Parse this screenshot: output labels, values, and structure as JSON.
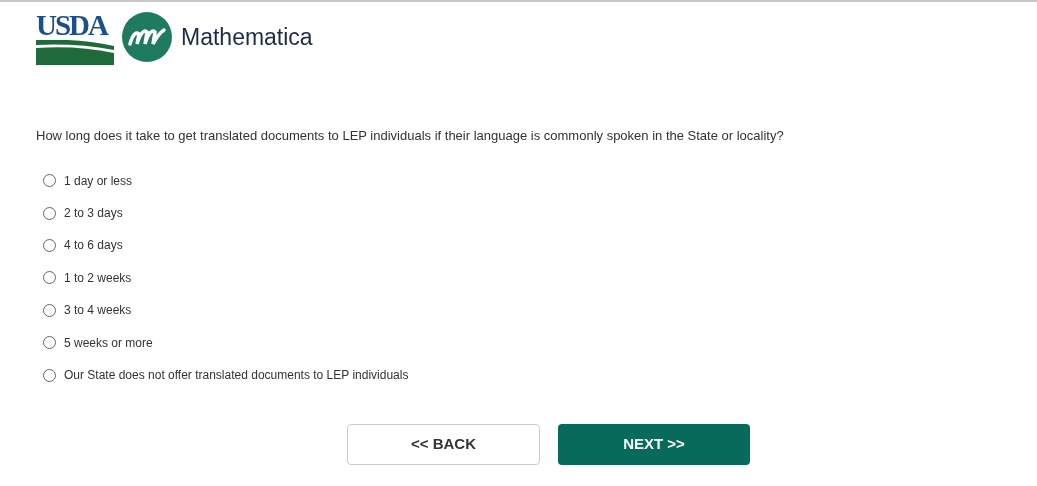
{
  "header": {
    "agency_logo": "USDA",
    "partner_logo": "Mathematica"
  },
  "question": "How long does it take to get translated documents to LEP individuals if their language is commonly spoken in the State or locality?",
  "options": [
    {
      "label": "1 day or less",
      "selected": false
    },
    {
      "label": "2 to 3 days",
      "selected": false
    },
    {
      "label": "4 to 6 days",
      "selected": false
    },
    {
      "label": "1 to 2 weeks",
      "selected": false
    },
    {
      "label": "3 to 4 weeks",
      "selected": false
    },
    {
      "label": "5 weeks or more",
      "selected": false
    },
    {
      "label": "Our State does not offer translated documents to LEP individuals",
      "selected": false
    }
  ],
  "buttons": {
    "back": "<< BACK",
    "next": "NEXT >>"
  }
}
